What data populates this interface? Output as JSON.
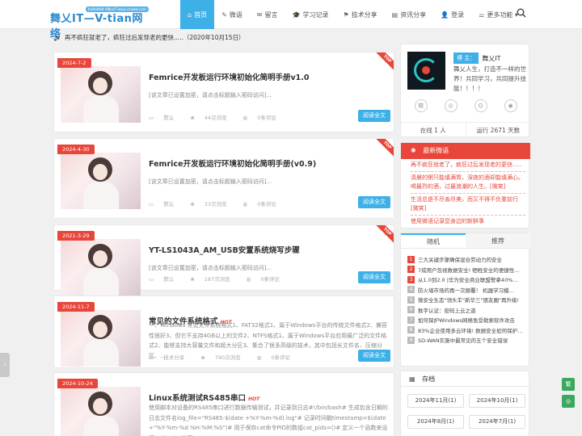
{
  "header": {
    "logo_text": "舞乂IT—V-tian网络",
    "logo_tagline": "ItoNaMaN #舞乂IT-www.cmwbk.com",
    "nav": [
      {
        "icon": "home-icon",
        "glyph": "⌂",
        "label": "首页"
      },
      {
        "icon": "weibo-icon",
        "glyph": "✎",
        "label": "微语"
      },
      {
        "icon": "message-icon",
        "glyph": "✉",
        "label": "留言"
      },
      {
        "icon": "study-icon",
        "glyph": "🎓",
        "label": "学习记录"
      },
      {
        "icon": "tech-icon",
        "glyph": "⚑",
        "label": "技术分享"
      },
      {
        "icon": "news-icon",
        "glyph": "▤",
        "label": "资讯分享"
      },
      {
        "icon": "user-icon",
        "glyph": "👤",
        "label": "登录"
      },
      {
        "icon": "more-icon",
        "glyph": "⚌",
        "label": "更多功能 ▾"
      }
    ]
  },
  "notice": {
    "text": "再不疯狂就老了，疯狂过后发现老的更快.....（2020年10月15日）"
  },
  "articles": [
    {
      "date": "2024-7-2",
      "title": "Femrice开发板运行环境初始化简明手册v1.0",
      "excerpt": "[该文章已设置加密，请点击标题输入密码访问]...",
      "category": "默认",
      "views": "44次浏览",
      "comments": "0条评论",
      "button": "阅读全文",
      "top": true,
      "hot": false
    },
    {
      "date": "2024-4-30",
      "title": "Femrice开发板运行环境初始化简明手册(v0.9)",
      "excerpt": "[该文章已设置加密，请点击标题输入密码访问]...",
      "category": "默认",
      "views": "33次浏览",
      "comments": "0条评论",
      "button": "阅读全文",
      "top": true,
      "hot": false
    },
    {
      "date": "2021-3-29",
      "title": "YT-LS1043A_AM_USB安置系统烧写步骤",
      "excerpt": "[该文章已设置加密，请点击标题输入密码访问]...",
      "category": "默认",
      "views": "187次浏览",
      "comments": "0条评论",
      "button": "阅读全文",
      "top": true,
      "hot": false
    },
    {
      "date": "2024-11-7",
      "title": "常见的文件系统格式",
      "excerpt": "一、Windows 常见文件系统格式1、FAT32格式1、属于Windows平台的传统文件格式2、兼容性很好3、但它不支持4GB以上的文件2、NTFS格式1、属于Windows平台应用最广泛的文件格式2、能够支持大容量文件和超大分区3、集合了很多高级的技术，其中包括长文件名、压缩分区、...",
      "category": "技术分享",
      "views": "790次浏览",
      "comments": "0条评论",
      "button": "阅读全文",
      "top": false,
      "hot": true
    },
    {
      "date": "2024-10-24",
      "title": "Linux系统测试RS485串口",
      "excerpt": "使用脚本对设备的RS485串口进行数据传输测试，并记录到日志#!/bin/bash# 生成包含日期的日志文件名log_file=\"RS485-$(date +%Y-%m-%d).log\"# 记录时间戳timestamp=$(date +\"%Y-%m-%d %H:%M:%S\")# 用于保存cat命令PID的数组cat_pids=()# 定义一个函数来设置tty的echo选项",
      "category": "",
      "views": "",
      "comments": "",
      "button": "",
      "top": false,
      "hot": true
    }
  ],
  "hot_label": "HOT",
  "top_label": "TOP",
  "profile": {
    "blogger_label": "博 主：",
    "name": "舞乂IT",
    "motto": "舞乂人生，打造不一样的世界！共同学习，共同提升技能！！！！",
    "socials": [
      {
        "name": "weibo-social-icon",
        "glyph": "微"
      },
      {
        "name": "wechat-social-icon",
        "glyph": "◎"
      },
      {
        "name": "qq-social-icon",
        "glyph": "Q"
      },
      {
        "name": "chrome-social-icon",
        "glyph": "◉"
      }
    ],
    "online": "在线 1 人",
    "running": "运行 2671 天数"
  },
  "weibo": {
    "title": "最新微语",
    "items": [
      "再不疯狂就老了，疯狂过后发现老的更快.....",
      "清晨的粥只能填满胃，深夜的酒却能填满心。喝最烈的酒，过最浪潮的人生。[微笑]",
      "生活总是不尽善尽美，而又不得不负重前行[微笑]",
      "使用微语记录您身边的新鲜事"
    ]
  },
  "tabs": {
    "random": "随机",
    "recommend": "推荐",
    "items": [
      {
        "n": "1",
        "text": "三大关键步骤确保混合劳动力的安全"
      },
      {
        "n": "2",
        "text": "7成用户忽视数据安全! 牺牲安全的便捷性…"
      },
      {
        "n": "3",
        "text": "从1.0到2.0 |华为安全商业联盟警拿40%…"
      },
      {
        "n": "4",
        "text": "防火墙市场的再一次颠覆！ 机器学习模…"
      },
      {
        "n": "5",
        "text": "微安全生态\"领头羊\"新华三\"朋友圈\"再升级!"
      },
      {
        "n": "6",
        "text": "数字认证：密码上云之道"
      },
      {
        "n": "7",
        "text": "如何保护Windows网络免受勒索软件攻击"
      },
      {
        "n": "8",
        "text": "83%企业使用多云环境! 数据安全如何保护…"
      },
      {
        "n": "9",
        "text": "SD-WAN实施中最常见的五个安全错误"
      }
    ]
  },
  "archive": {
    "title": "存档",
    "items": [
      "2024年11月(1)",
      "2024年10月(1)",
      "2024年8月(1)",
      "2024年7月(1)"
    ]
  },
  "float": {
    "simplified": "繁",
    "wechat_glyph": "◎"
  }
}
